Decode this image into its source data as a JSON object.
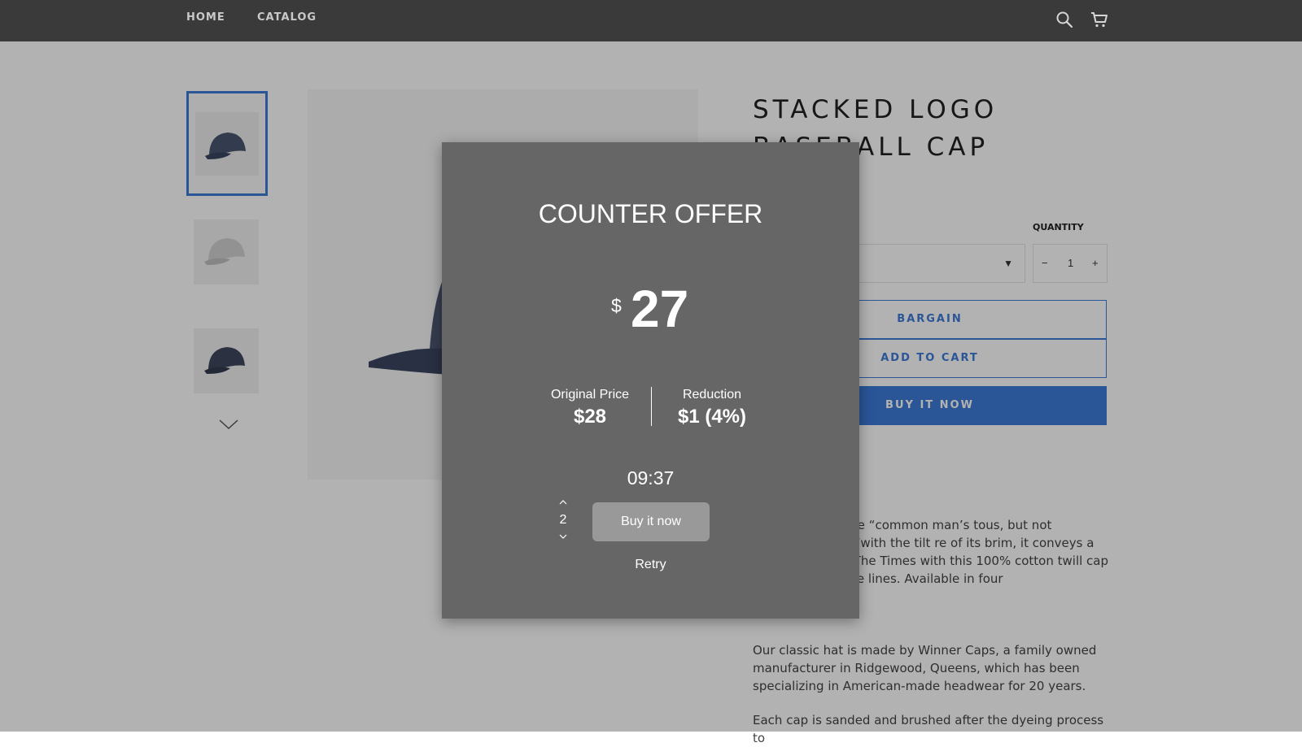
{
  "header": {
    "nav": [
      {
        "label": "HOME"
      },
      {
        "label": "CATALOG"
      }
    ],
    "icons": [
      "search-icon",
      "cart-icon"
    ]
  },
  "product": {
    "title": "STACKED LOGO BASEBALL CAP",
    "quantity_label": "QUANTITY",
    "quantity_value": "1",
    "quantity_minus": "−",
    "quantity_plus": "+",
    "bargain_label": "BARGAIN",
    "add_to_cart_label": "ADD TO CART",
    "buy_it_now_label": "BUY IT NOW",
    "description": [
      "e baseball cap the “common man’s tous, but not anonymous and “with the tilt re of its brim, it conveys a point of view.” r The Times with this 100% cotton twill cap nic name on three lines. Available in four",
      "Our classic hat is made by Winner Caps, a family owned manufacturer in Ridgewood, Queens, which has been specializing in American-made headwear for 20 years.",
      "Each cap is sanded and brushed after the dyeing process to"
    ]
  },
  "modal": {
    "title": "COUNTER OFFER",
    "currency": "$",
    "offer_amount": "27",
    "original_price_label": "Original Price",
    "original_price_value": "$28",
    "reduction_label": "Reduction",
    "reduction_value": "$1 (4%)",
    "timer": "09:37",
    "stepper_value": "2",
    "buy_button_label": "Buy it now",
    "retry_label": "Retry"
  },
  "colors": {
    "header_bg": "#3a3a3a",
    "accent": "#3d7ad8",
    "modal_bg": "#666666",
    "modal_button_bg": "#999999"
  }
}
